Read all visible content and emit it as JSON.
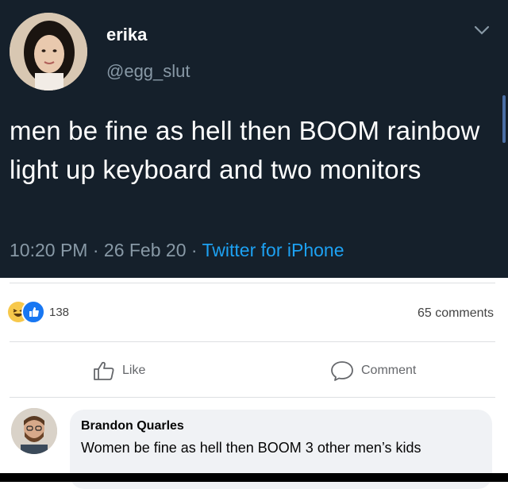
{
  "tweet": {
    "display_name": "erika",
    "handle": "@egg_slut",
    "text": "men be fine as hell then BOOM rainbow light up keyboard and two monitors",
    "time": "10:20 PM",
    "date": "26 Feb 20",
    "source": "Twitter for iPhone",
    "separator": " · "
  },
  "facebook": {
    "reaction_count": "138",
    "comments_count": "65 comments",
    "like_label": "Like",
    "comment_label": "Comment",
    "comment": {
      "author": "Brandon Quarles",
      "text": "Women be fine as hell then BOOM 3 other men’s kids"
    }
  },
  "colors": {
    "tweet_bg": "#15202b",
    "tweet_muted": "#8899a6",
    "tweet_link": "#1da1f2",
    "fb_like_blue": "#1877f2",
    "fb_bubble": "#f0f2f5"
  }
}
